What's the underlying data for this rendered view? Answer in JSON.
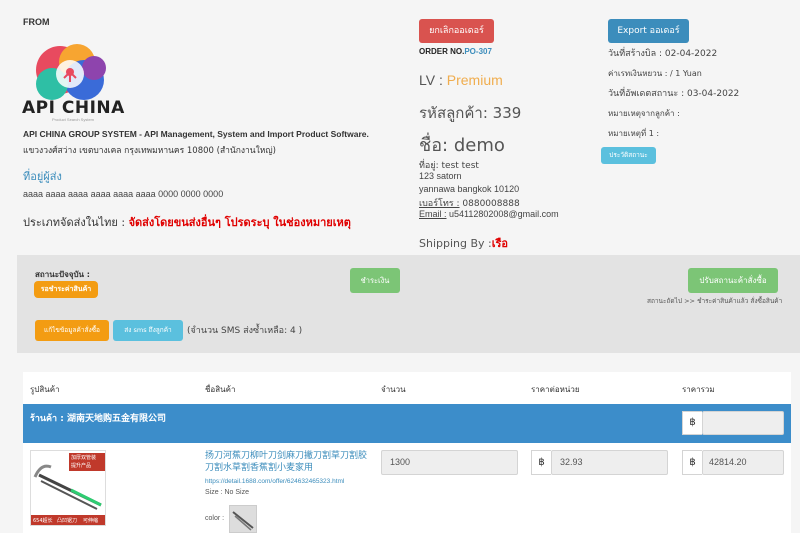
{
  "header": {
    "from_label": "FROM",
    "logo_text": "API CHINA",
    "logo_subtext": "Product Search System",
    "company_name": "API CHINA GROUP SYSTEM - API Management, System and Import Product Software.",
    "company_address": "แขวงวงศ์สว่าง เขตบางเคล กรุงเทพมหานคร 10800 (สำนักงานใหญ่)",
    "sender_link": "ที่อยู่ผู้ส่ง",
    "sender_address": "aaaa aaaa aaaa aaaa aaaa aaaa 0000 0000 0000",
    "shipping_type_label": "ประเภทจัดส่งในไทย :",
    "shipping_type_value": "จัดส่งโดยขนส่งอื่นๆ โปรดระบุ ในช่องหมายเหตุ"
  },
  "customer": {
    "cancel_button": "ยกเลิกออเดอร์",
    "order_no_label": "ORDER NO.",
    "order_no": "PO-307",
    "level_label": "LV :",
    "level_value": "Premium",
    "customer_code_label": "รหัสลูกค้า:",
    "customer_code": "339",
    "name_label": "ชื่อ:",
    "name": "demo",
    "address_line1": "ที่อยู่: test test",
    "address_line2": "123 satorn",
    "address_line3": "yannawa bangkok 10120",
    "phone_label": "เบอร์โทร :",
    "phone": "0880008888",
    "email_label": "Email :",
    "email": "u54112802008@gmail.com",
    "shipping_by_label": "Shipping By :",
    "shipping_by_value": "เรือ"
  },
  "order_info": {
    "export_button": "Export ออเดอร์",
    "created_date": "วันที่สร้างบิล : 02-04-2022",
    "exchange_rate": "ค่าเรทเงินหยวน : / 1 Yuan",
    "updated_date": "วันที่อัพเดตสถานะ : 03-04-2022",
    "customer_note": "หมายเหตุจากลูกค้า :",
    "note1": "หมายเหตุที่ 1 :",
    "history_button": "ประวัติสถานะ"
  },
  "status_panel": {
    "current_status_label": "สถานะปัจจุบัน :",
    "status_badge": "รอชำระค่าสินค้า",
    "pay_button": "ชำระเงิน",
    "update_status_button": "ปรับสถานะค้าสั่งซื้อ",
    "next_status_text": "สถานะถัดไป >> ชำระค่าสินค้าแล้ว สั่งซื้อสินค้า",
    "edit_order_button": "แก้ไขข้อมูลค้าสั่งซื้อ",
    "send_sms_button": "ส่ง sms ถึงลูกค้า",
    "sms_remaining": "(จำนวน SMS ส่งซ้ำเหลือ: 4 )"
  },
  "table": {
    "columns": [
      "รูปสินค้า",
      "ชื่อสินค้า",
      "จำนวน",
      "ราคาต่อหน่วย",
      "ราคารวม"
    ],
    "shop_label": "ร้านค้า : 湖南天地购五金有限公司",
    "currency_symbol": "฿",
    "item": {
      "image_tags": [
        "加厚双管装",
        "提升产品"
      ],
      "image_footer": [
        "654超长",
        "凸凹锯刀",
        "可伸缩"
      ],
      "title": "扬刀河蕉刀柳叶刀剑麻刀撇刀割草刀割胶刀割水草割香蕉割小麦家用",
      "url": "https://detail.1688.com/offer/624632465323.html",
      "size": "Size : No Size",
      "color_label": "color :",
      "quantity": "1300",
      "unit_price": "32.93",
      "total_price": "42814.20"
    }
  },
  "colors": {
    "cancel": "#d9534f",
    "export": "#3c8dbc",
    "info": "#5bc0de",
    "success": "#7cc576",
    "warning": "#f39c12",
    "shop_bar": "#3c8dca",
    "link": "#3c8dbc",
    "premium": "#f0ad4e",
    "alert_red": "#e00000"
  }
}
